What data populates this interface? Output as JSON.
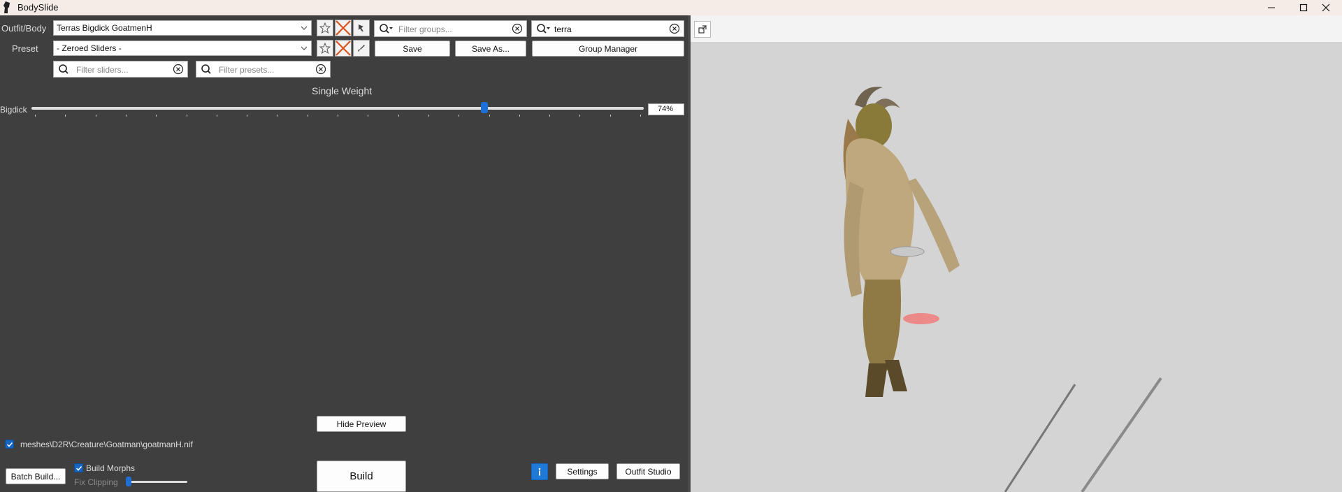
{
  "window": {
    "title": "BodySlide"
  },
  "outfit": {
    "label": "Outfit/Body",
    "value": "Terras Bigdick GoatmenH"
  },
  "preset": {
    "label": "Preset",
    "value": "- Zeroed Sliders -"
  },
  "filters": {
    "groups_placeholder": "Filter groups...",
    "outfit_filter_value": "terra",
    "sliders_placeholder": "Filter sliders...",
    "presets_placeholder": "Filter presets..."
  },
  "buttons": {
    "save": "Save",
    "save_as": "Save As...",
    "group_manager": "Group Manager",
    "hide_preview": "Hide Preview",
    "build": "Build",
    "batch_build": "Batch Build...",
    "settings": "Settings",
    "outfit_studio": "Outfit Studio"
  },
  "weight_header": "Single Weight",
  "sliders": [
    {
      "name": "Bigdick",
      "value": 74,
      "value_text": "74%"
    }
  ],
  "output": {
    "file": "meshes\\D2R\\Creature\\Goatman\\goatmanH.nif",
    "checked": true
  },
  "options": {
    "build_morphs_label": "Build Morphs",
    "build_morphs_checked": true,
    "fix_clipping_label": "Fix Clipping"
  },
  "colors": {
    "accent": "#1e6fd6",
    "panel": "#3f3f3f",
    "preview_bg": "#d4d4d4"
  },
  "icons": [
    "app-icon",
    "minimize-icon",
    "maximize-icon",
    "close-icon",
    "star-icon",
    "delete-icon",
    "pin-icon",
    "brush-icon",
    "search-icon",
    "clear-icon",
    "chevron-down-icon",
    "info-icon",
    "popout-icon"
  ]
}
